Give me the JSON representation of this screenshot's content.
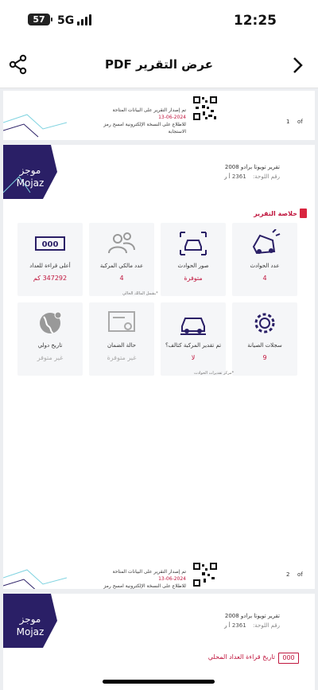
{
  "status": {
    "time": "12:25",
    "battery": "57",
    "network": "5G"
  },
  "nav": {
    "title": "عرض التقرير PDF",
    "share_icon": "share-icon",
    "back_icon": "chevron-right-icon"
  },
  "page_footer_1": {
    "issue_line": "تم إصدار التقرير على البيانات المتاحة",
    "date": "2024-06-13",
    "scan_line": "للاطلاع على النسخة الإلكترونية امسح رمز الاستجابة",
    "page_number": "1",
    "of": "of"
  },
  "report": {
    "logo_ar": "موجز",
    "logo_en": "Mojaz",
    "vehicle_name": "تقرير تويوتا برادو 2008",
    "plate_label": "رقم اللوحة:",
    "plate_value": "2361 أ ر",
    "section_title": "خلاصة التقرير",
    "cards": [
      {
        "label": "عدد الحوادث",
        "value": "4",
        "icon": "car-crash-icon"
      },
      {
        "label": "صور الحوادث",
        "value": "متوفرة",
        "icon": "camera-car-icon"
      },
      {
        "label": "عدد مالكي المركبة",
        "value": "4",
        "icon": "owners-icon"
      },
      {
        "label": "أعلى قراءة للعداد",
        "value": "347292 كم",
        "icon": "odometer-icon"
      },
      {
        "label": "سجلات الصيانة",
        "value": "9",
        "icon": "gear-icon"
      },
      {
        "label": "تم تقدير المركبة كتالف؟",
        "value": "لا",
        "icon": "car-total-loss-icon"
      },
      {
        "label": "حالة الضمان",
        "value": "غير متوفرة",
        "icon": "certificate-icon"
      },
      {
        "label": "تاريخ دولي",
        "value": "غير متوفر",
        "icon": "globe-icon"
      }
    ],
    "owners_note": "*يشمل المالك الحالي",
    "estimate_note": "*مركز تقديرات الحوادث"
  },
  "page_footer_2": {
    "issue_line": "تم إصدار التقرير على البيانات المتاحة",
    "date": "2024-06-13",
    "scan_line": "للاطلاع على النسخة الإلكترونية امسح رمز الاستجابة",
    "page_number": "2",
    "of": "of"
  },
  "report_page_2": {
    "logo_ar": "موجز",
    "logo_en": "Mojaz",
    "vehicle_name": "تقرير تويوتا برادو 2008",
    "plate_label": "رقم اللوحة:",
    "plate_value": "2361 أ ر",
    "section_title": "تاريخ قراءة العداد المحلي",
    "odo_digits": "000"
  },
  "colors": {
    "brand_purple": "#2a1f66",
    "accent_red": "#c0163e"
  }
}
